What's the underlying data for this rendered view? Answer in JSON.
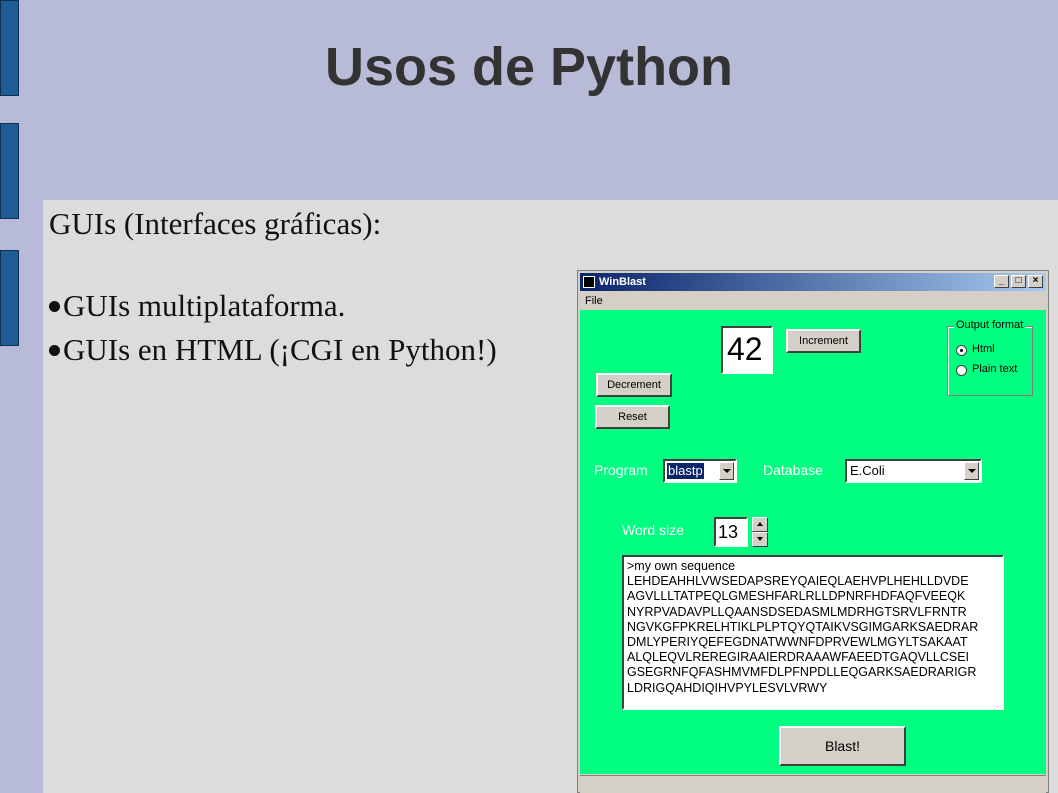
{
  "slide": {
    "title": "Usos de Python",
    "heading": "GUIs (Interfaces gráficas):",
    "bullets": [
      "GUIs multiplataforma.",
      "GUIs en HTML (¡CGI en Python!)"
    ]
  },
  "window": {
    "title": "WinBlast",
    "menu": [
      "File"
    ],
    "counter_value": "42",
    "buttons": {
      "increment": "Increment",
      "decrement": "Decrement",
      "reset": "Reset",
      "blast": "Blast!"
    },
    "output_format": {
      "title": "Output format",
      "options": [
        "Html",
        "Plain text"
      ],
      "selected": "Html"
    },
    "program": {
      "label": "Program",
      "value": "blastp"
    },
    "database": {
      "label": "Database",
      "value": "E.Coli"
    },
    "word_size": {
      "label": "Word size",
      "value": "13"
    },
    "sequence": [
      ">my own sequence",
      "LEHDEAHHLVWSEDAPSREYQAIEQLAEHVPLHEHLLDVDE",
      "AGVLLLTATPEQLGMESHFARLRLLDPNRFHDFAQFVEEQK",
      "NYRPVADAVPLLQAANSDSEDASMLMDRHGTSRVLFRNTR",
      "NGVKGFPKRELHTIKLPLPTQYQTAIKVSGIMGARKSAEDRAR",
      "DMLYPERIYQEFEGDNATWWNFDPRVEWLMGYLTSAKAAT",
      "ALQLEQVLREREGIRAAIERDRAAAWFAEEDTGAQVLLCSEI",
      "GSEGRNFQFASHMVMFDLPFNPDLLEQGARKSAEDRARIGR",
      "LDRIGQAHDIQIHVPYLESVLVRWY"
    ]
  },
  "colors": {
    "client_bg": "#00ff80",
    "slide_bg": "#b8bbd8",
    "content_bg": "#dcdcdc",
    "tab": "#1e5c93"
  }
}
